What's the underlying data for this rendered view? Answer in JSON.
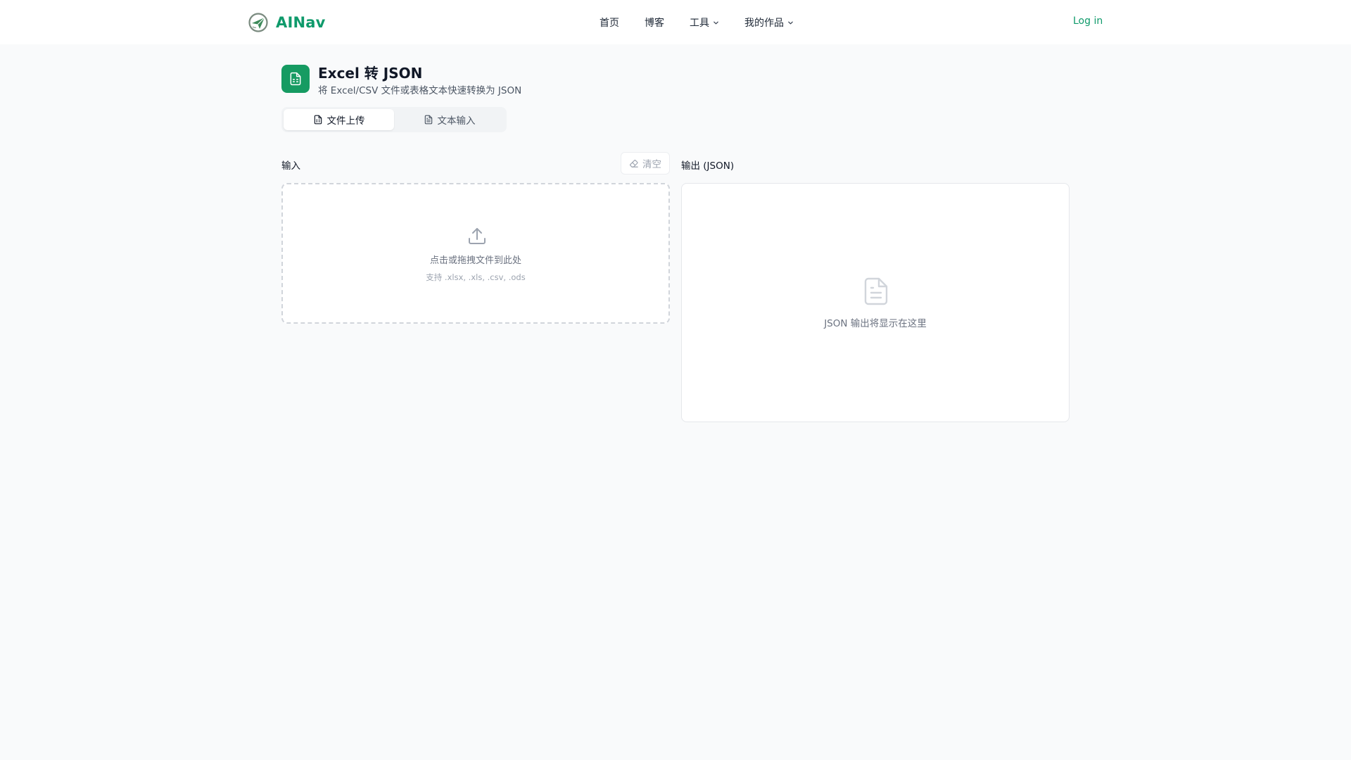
{
  "header": {
    "brand": "AINav",
    "nav": [
      {
        "label": "首页",
        "has_dropdown": false
      },
      {
        "label": "博客",
        "has_dropdown": false
      },
      {
        "label": "工具",
        "has_dropdown": true
      },
      {
        "label": "我的作品",
        "has_dropdown": true
      }
    ],
    "login": "Log in"
  },
  "page": {
    "title": "Excel 转 JSON",
    "subtitle": "将 Excel/CSV 文件或表格文本快速转换为 JSON"
  },
  "tabs": [
    {
      "label": "文件上传",
      "active": true
    },
    {
      "label": "文本输入",
      "active": false
    }
  ],
  "input_panel": {
    "label": "输入",
    "clear_label": "清空",
    "dropzone_text": "点击或拖拽文件到此处",
    "dropzone_hint": "支持 .xlsx, .xls, .csv, .ods"
  },
  "output_panel": {
    "label": "输出 (JSON)",
    "placeholder": "JSON 输出将显示在这里"
  },
  "colors": {
    "brand": "#0f9a6b",
    "tool_icon_bg": "#169b62",
    "page_bg": "#f9fafb"
  },
  "icons": {
    "logo": "paper-plane-logo-icon",
    "tool": "spreadsheet-file-icon",
    "upload": "upload-icon",
    "eraser": "eraser-icon",
    "file": "file-icon",
    "file_text": "file-text-icon"
  }
}
